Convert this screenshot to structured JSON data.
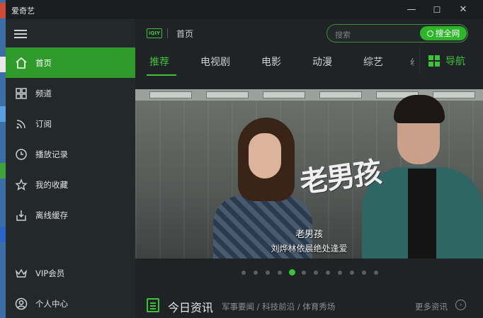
{
  "window": {
    "title": "爱奇艺",
    "minimize_glyph": "—",
    "maximize_glyph": "☐",
    "close_glyph": "✕"
  },
  "sidebar": {
    "items": [
      {
        "label": "首页",
        "icon": "home-icon",
        "active": true
      },
      {
        "label": "频道",
        "icon": "grid-icon",
        "active": false
      },
      {
        "label": "订阅",
        "icon": "rss-icon",
        "active": false
      },
      {
        "label": "播放记录",
        "icon": "clock-icon",
        "active": false
      },
      {
        "label": "我的收藏",
        "icon": "star-icon",
        "active": false
      },
      {
        "label": "离线缓存",
        "icon": "download-icon",
        "active": false
      },
      {
        "label": "VIP会员",
        "icon": "vip-crown-icon",
        "active": false
      },
      {
        "label": "个人中心",
        "icon": "user-icon",
        "active": false
      }
    ]
  },
  "header": {
    "logo_text": "iQIY",
    "breadcrumb": "首页",
    "search": {
      "placeholder": "搜索",
      "button_label": "搜全网"
    }
  },
  "tabs": {
    "items": [
      "推荐",
      "电视剧",
      "电影",
      "动漫",
      "综艺"
    ],
    "active_index": 0,
    "guide_label": "导航"
  },
  "banner": {
    "show_logo": "老男孩",
    "caption_title": "老男孩",
    "caption_subtitle": "刘烨林依晨绝处逢爱",
    "slide_count": 12,
    "active_slide": 4
  },
  "news": {
    "title": "今日资讯",
    "tags": "军事要闻 / 科技前沿 / 体育秀场",
    "more_label": "更多资讯"
  },
  "colors": {
    "accent": "#3fc13a",
    "sidebar_active": "#2e9b2a",
    "sidebar_bg": "#23282b",
    "main_bg": "#1f2326"
  }
}
